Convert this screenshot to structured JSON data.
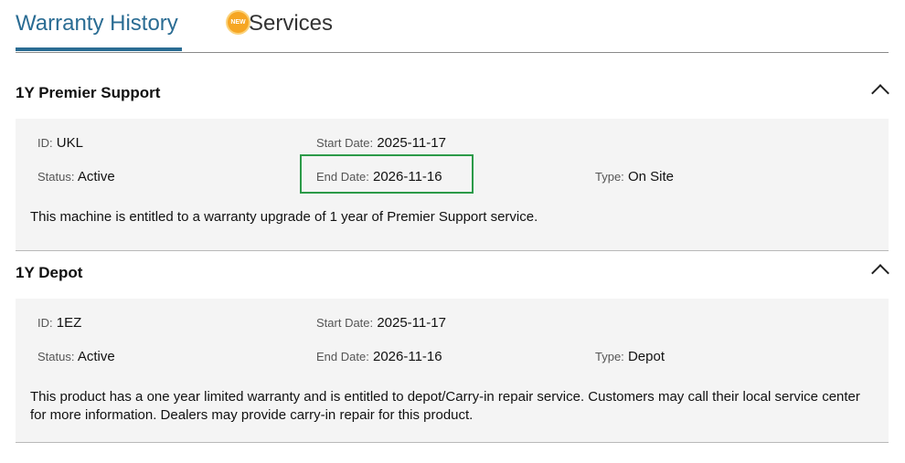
{
  "tabs": {
    "warranty_history": "Warranty History",
    "services_badge": "NEW",
    "services": "Services"
  },
  "labels": {
    "id": "ID:",
    "status": "Status:",
    "start_date": "Start Date:",
    "end_date": "End Date:",
    "type": "Type:"
  },
  "warranties": [
    {
      "title": "1Y Premier Support",
      "id": "UKL",
      "status": "Active",
      "start_date": "2025-11-17",
      "end_date": "2026-11-16",
      "type": "On Site",
      "description": "This machine is entitled to a warranty upgrade of 1 year of Premier Support service."
    },
    {
      "title": "1Y Depot",
      "id": "1EZ",
      "status": "Active",
      "start_date": "2025-11-17",
      "end_date": "2026-11-16",
      "type": "Depot",
      "description": "This product has a one year limited warranty and is entitled to depot/Carry-in repair service. Customers may call their local service center for more information. Dealers may provide carry-in repair for this product."
    }
  ],
  "colors": {
    "accent": "#2a6c93",
    "highlight": "#2b9a48",
    "badge": "#f6a623"
  }
}
